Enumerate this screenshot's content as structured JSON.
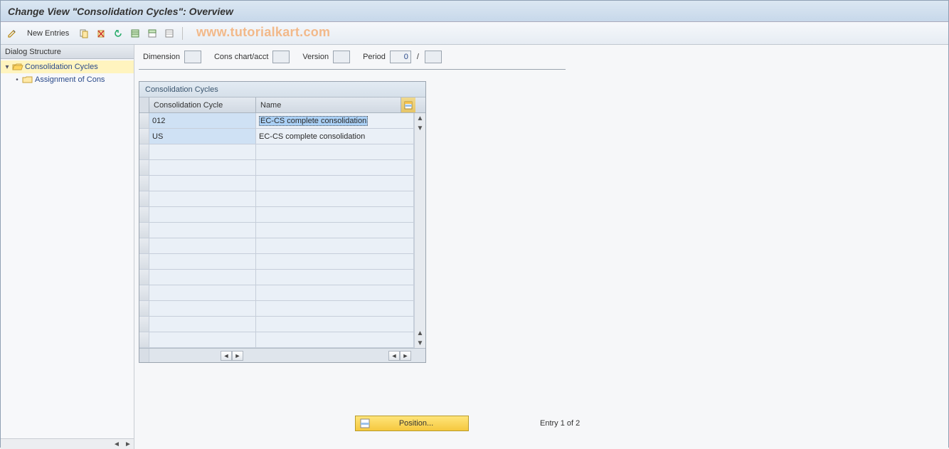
{
  "title": "Change View \"Consolidation Cycles\": Overview",
  "watermark": "www.tutorialkart.com",
  "toolbar": {
    "new_entries": "New Entries"
  },
  "tree": {
    "header": "Dialog Structure",
    "node_root": "Consolidation Cycles",
    "node_child": "Assignment of Cons"
  },
  "params": {
    "dimension_label": "Dimension",
    "dimension_value": "",
    "chart_label": "Cons chart/acct",
    "chart_value": "",
    "version_label": "Version",
    "version_value": "",
    "period_label": "Period",
    "period_a": "0",
    "period_b": ""
  },
  "group": {
    "title": "Consolidation Cycles",
    "col1": "Consolidation Cycle",
    "col2": "Name",
    "rows": [
      {
        "cycle": "012",
        "name": "EC-CS complete consolidation",
        "selected": true
      },
      {
        "cycle": "US",
        "name": "EC-CS complete consolidation",
        "selected": false
      }
    ]
  },
  "bottom": {
    "position": "Position...",
    "entry": "Entry 1 of 2"
  }
}
